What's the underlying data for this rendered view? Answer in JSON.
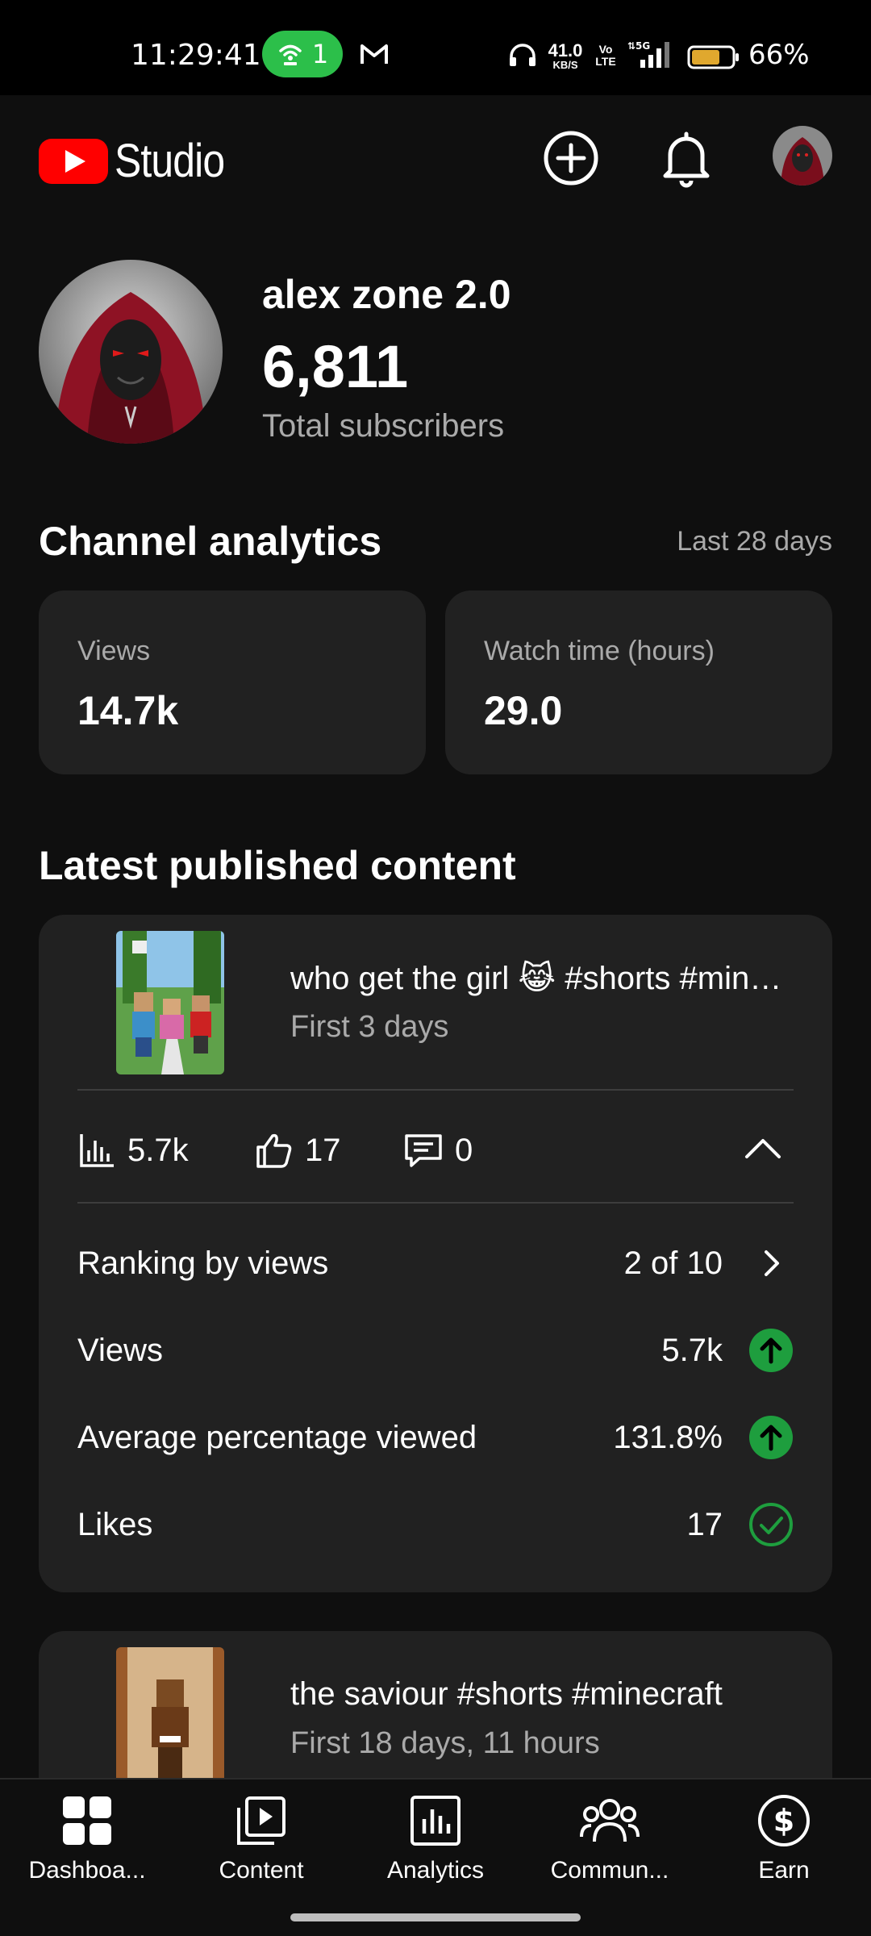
{
  "status_bar": {
    "time": "11:29:41",
    "hotspot_count": "1",
    "net_speed_value": "41.0",
    "net_speed_unit": "KB/S",
    "volte": "Vo LTE",
    "network": "5G",
    "battery_percent": "66%",
    "icons": [
      "hotspot-icon",
      "gmail-icon",
      "headphone-icon",
      "signal-icon",
      "battery-icon"
    ]
  },
  "header": {
    "app_name": "Studio",
    "icons": [
      "youtube-logo-icon",
      "create-plus-icon",
      "notification-bell-icon",
      "account-avatar"
    ]
  },
  "channel": {
    "name": "alex zone 2.0",
    "subscribers": "6,811",
    "subscribers_label": "Total subscribers"
  },
  "analytics": {
    "title": "Channel analytics",
    "range": "Last 28 days",
    "cards": [
      {
        "label": "Views",
        "value": "14.7k"
      },
      {
        "label": "Watch time (hours)",
        "value": "29.0"
      }
    ]
  },
  "latest": {
    "title": "Latest published content",
    "items": [
      {
        "title": "who get the girl 😹 #shorts #minecraft",
        "subtitle": "First 3 days",
        "views": "5.7k",
        "likes": "17",
        "comments": "0",
        "details": [
          {
            "label": "Ranking by views",
            "value": "2 of 10",
            "icon": "chevron-right-icon"
          },
          {
            "label": "Views",
            "value": "5.7k",
            "icon": "arrow-up-green-icon"
          },
          {
            "label": "Average percentage viewed",
            "value": "131.8%",
            "icon": "arrow-up-green-icon"
          },
          {
            "label": "Likes",
            "value": "17",
            "icon": "check-circle-icon"
          }
        ]
      },
      {
        "title": "the saviour #shorts #minecraft",
        "subtitle": "First 18 days, 11 hours"
      }
    ]
  },
  "nav": [
    {
      "label": "Dashboa...",
      "icon": "dashboard-icon"
    },
    {
      "label": "Content",
      "icon": "content-icon"
    },
    {
      "label": "Analytics",
      "icon": "analytics-icon"
    },
    {
      "label": "Commun...",
      "icon": "community-icon"
    },
    {
      "label": "Earn",
      "icon": "earn-icon"
    }
  ],
  "colors": {
    "background": "#0f0f0f",
    "card": "#212121",
    "youtube_red": "#ff0000",
    "accent_green": "#1e9e3e",
    "text_secondary": "#aaaaaa"
  }
}
